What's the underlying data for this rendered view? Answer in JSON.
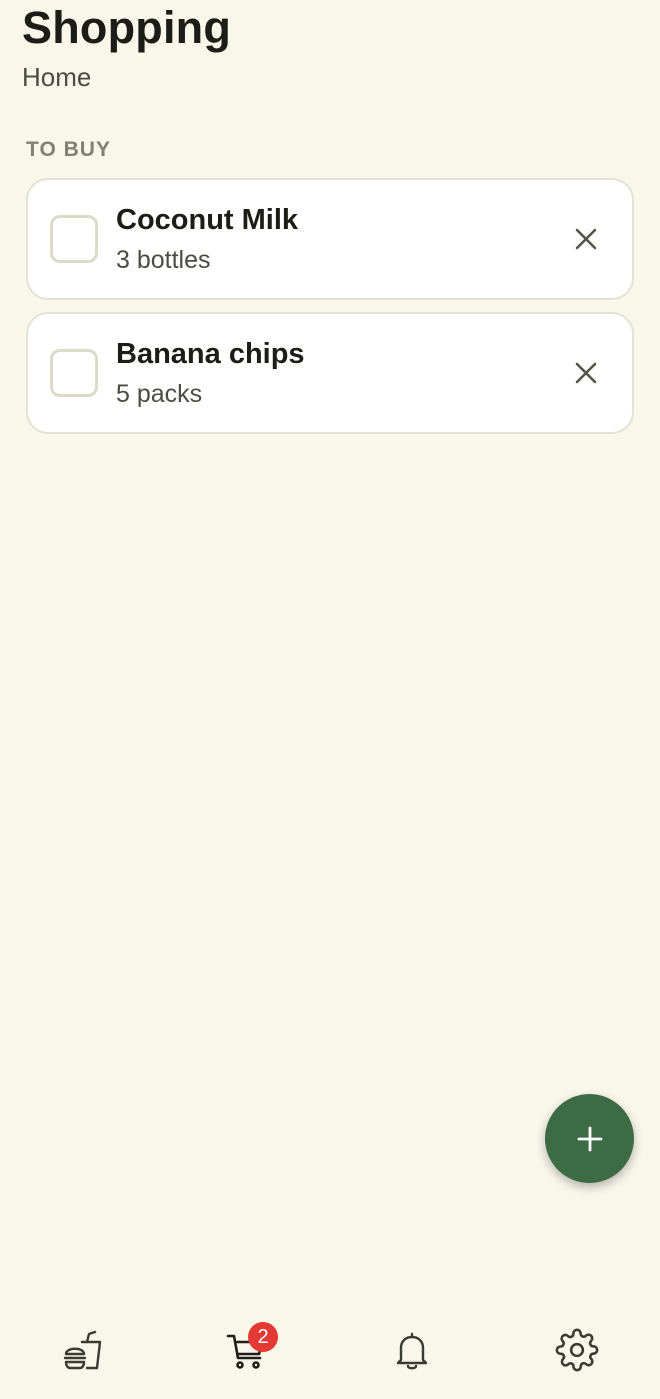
{
  "header": {
    "title": "Shopping",
    "subtitle": "Home"
  },
  "section": {
    "label": "TO BUY"
  },
  "items": [
    {
      "name": "Coconut Milk",
      "quantity": "3 bottles",
      "checked": false
    },
    {
      "name": "Banana chips",
      "quantity": "5 packs",
      "checked": false
    }
  ],
  "fab": {
    "icon": "plus-icon",
    "color": "#3d6b45"
  },
  "bottom_nav": {
    "items": [
      {
        "icon": "fast-food-icon"
      },
      {
        "icon": "shopping-cart-icon",
        "badge": "2",
        "active": true
      },
      {
        "icon": "bell-icon"
      },
      {
        "icon": "gear-icon"
      }
    ]
  },
  "colors": {
    "background": "#f9f7ea",
    "accent": "#3d6b45",
    "badge": "#e53935"
  }
}
